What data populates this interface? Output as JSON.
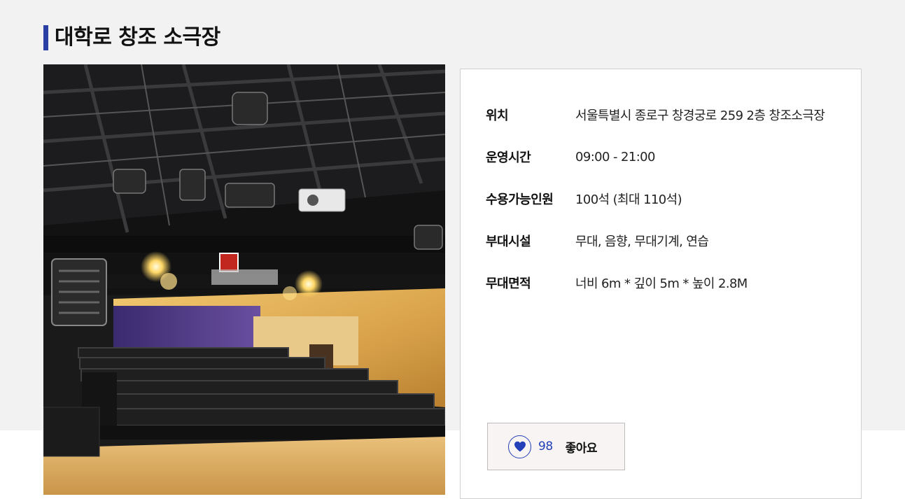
{
  "page": {
    "title": "대학로 창조 소극장"
  },
  "photo": {
    "icon": "theater-photo"
  },
  "info": {
    "rows": [
      {
        "label": "위치",
        "value": "서울특별시 종로구 창경궁로 259 2층 창조소극장"
      },
      {
        "label": "운영시간",
        "value": "09:00 - 21:00"
      },
      {
        "label": "수용가능인원",
        "value": "100석 (최대 110석)"
      },
      {
        "label": "부대시설",
        "value": "무대, 음향, 무대기계, 연습"
      },
      {
        "label": "무대면적",
        "value": "너비 6m * 깊이 5m * 높이 2.8M"
      }
    ]
  },
  "like": {
    "count": "98",
    "label": "좋아요",
    "icon": "heart-icon"
  },
  "colors": {
    "accent": "#2a3fa3",
    "like_blue": "#2440b8",
    "band_bg": "#f2f2f3",
    "card_border": "#cfcfcf"
  }
}
